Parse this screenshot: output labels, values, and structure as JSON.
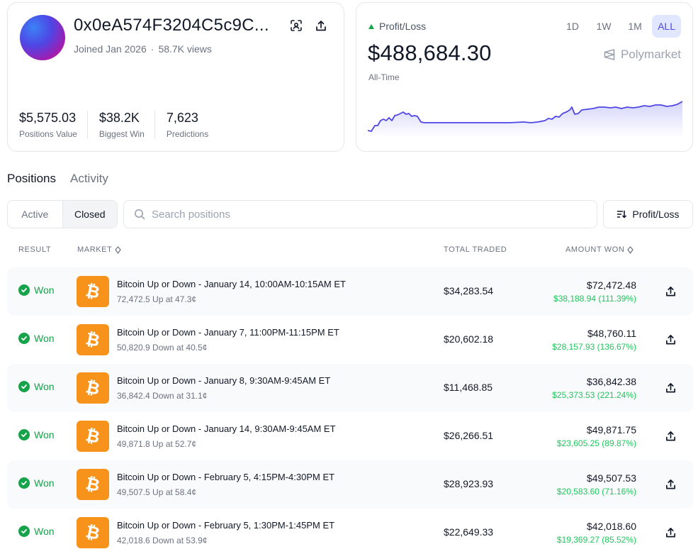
{
  "profile": {
    "wallet": "0x0eA574F3204C5c9C...",
    "joined": "Joined Jan 2026",
    "views": "58.7K views",
    "stats": [
      {
        "value": "$5,575.03",
        "label": "Positions Value"
      },
      {
        "value": "$38.2K",
        "label": "Biggest Win"
      },
      {
        "value": "7,623",
        "label": "Predictions"
      }
    ]
  },
  "pnl": {
    "label": "Profit/Loss",
    "value": "$488,684.30",
    "period": "All-Time",
    "brand": "Polymarket",
    "timeframes": [
      "1D",
      "1W",
      "1M",
      "ALL"
    ],
    "active_timeframe": "ALL",
    "colors": {
      "line": "#4f46e5",
      "up": "#16a34a"
    }
  },
  "tabs": [
    {
      "label": "Positions",
      "active": true
    },
    {
      "label": "Activity",
      "active": false
    }
  ],
  "filters": {
    "segments": [
      "Active",
      "Closed"
    ],
    "active_segment": "Closed",
    "search_placeholder": "Search positions",
    "sort_label": "Profit/Loss"
  },
  "table": {
    "headers": {
      "result": "RESULT",
      "market": "MARKET",
      "total_traded": "TOTAL TRADED",
      "amount_won": "AMOUNT WON"
    },
    "rows": [
      {
        "result": "Won",
        "title": "Bitcoin Up or Down - January 14, 10:00AM-10:15AM ET",
        "sub": "72,472.5 Up at 47.3¢",
        "traded": "$34,283.54",
        "won": "$72,472.48",
        "gain": "$38,188.94 (111.39%)"
      },
      {
        "result": "Won",
        "title": "Bitcoin Up or Down - January 7, 11:00PM-11:15PM ET",
        "sub": "50,820.9 Down at 40.5¢",
        "traded": "$20,602.18",
        "won": "$48,760.11",
        "gain": "$28,157.93 (136.67%)"
      },
      {
        "result": "Won",
        "title": "Bitcoin Up or Down - January 8, 9:30AM-9:45AM ET",
        "sub": "36,842.4 Down at 31.1¢",
        "traded": "$11,468.85",
        "won": "$36,842.38",
        "gain": "$25,373.53 (221.24%)"
      },
      {
        "result": "Won",
        "title": "Bitcoin Up or Down - January 14, 9:30AM-9:45AM ET",
        "sub": "49,871.8 Up at 52.7¢",
        "traded": "$26,266.51",
        "won": "$49,871.75",
        "gain": "$23,605.25 (89.87%)"
      },
      {
        "result": "Won",
        "title": "Bitcoin Up or Down - February 5, 4:15PM-4:30PM ET",
        "sub": "49,507.5 Up at 58.4¢",
        "traded": "$28,923.93",
        "won": "$49,507.53",
        "gain": "$20,583.60 (71.16%)"
      },
      {
        "result": "Won",
        "title": "Bitcoin Up or Down - February 5, 1:30PM-1:45PM ET",
        "sub": "42,018.6 Down at 53.9¢",
        "traded": "$22,649.33",
        "won": "$42,018.60",
        "gain": "$19,369.27 (85.52%)"
      }
    ]
  }
}
